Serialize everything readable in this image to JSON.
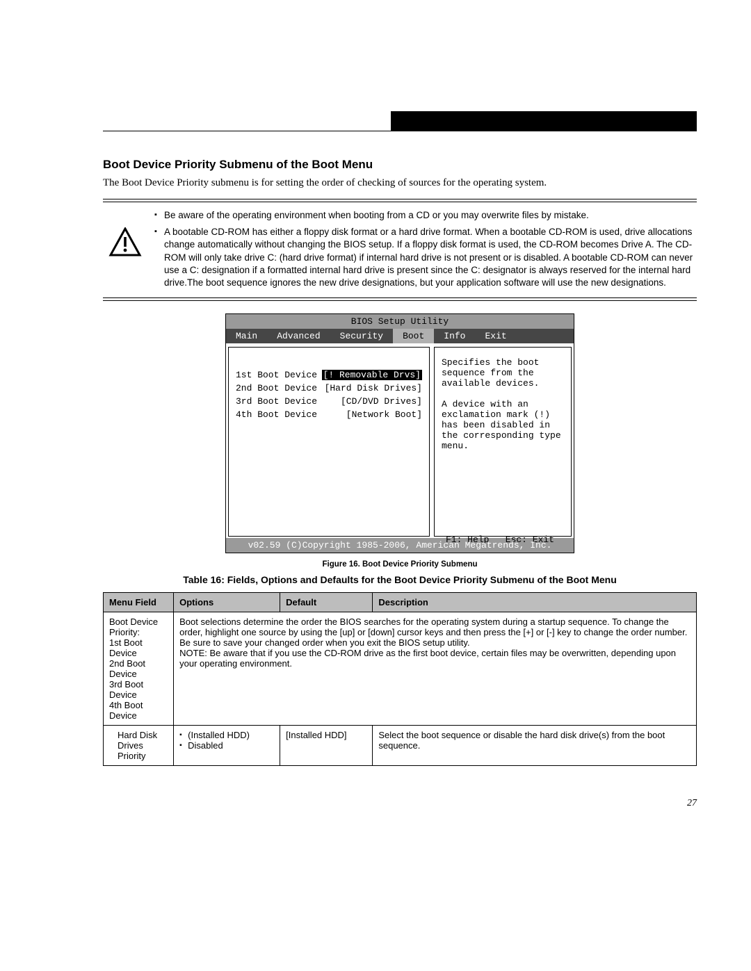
{
  "header": {
    "section_title": "Boot Device Priority Submenu of the Boot Menu",
    "intro": "The Boot Device Priority submenu is for setting the order of checking of sources for the operating system."
  },
  "notice": {
    "items": [
      "Be aware of the operating environment when booting from a CD or you may overwrite files by mistake.",
      "A bootable CD-ROM has either a floppy disk format or a hard drive format. When a bootable CD-ROM is used, drive allocations change automatically without changing the BIOS setup. If a floppy disk format is used, the CD-ROM becomes Drive A. The CD-ROM will only take drive C: (hard drive format) if internal hard drive is not present or is disabled. A bootable CD-ROM can never use a C: designation if a formatted internal hard drive is present since the C: designator is always reserved for the internal hard drive.The boot sequence ignores the new drive designations, but your application software will use the new designations."
    ]
  },
  "bios": {
    "title": "BIOS Setup Utility",
    "tabs": [
      "Main",
      "Advanced",
      "Security",
      "Boot",
      "Info",
      "Exit"
    ],
    "active_tab": "Boot",
    "left_rows": [
      {
        "label": "1st Boot Device",
        "value": "[! Removable Drvs]",
        "selected": true
      },
      {
        "label": "2nd Boot Device",
        "value": "[Hard Disk Drives]",
        "selected": false
      },
      {
        "label": "3rd Boot Device",
        "value": "[CD/DVD Drives]",
        "selected": false
      },
      {
        "label": "4th Boot Device",
        "value": "[Network Boot]",
        "selected": false
      }
    ],
    "right_text": "Specifies the boot sequence from the available devices.\n\nA device with an exclamation mark (!) has been disabled in the corresponding type menu.",
    "keys_line": "F1: Help   Esc: Exit",
    "footer": "v02.59 (C)Copyright 1985-2006, American Megatrends, Inc."
  },
  "figure_caption": "Figure 16.  Boot Device Priority Submenu",
  "table_title": "Table 16: Fields, Options and Defaults for the Boot Device Priority Submenu of the Boot Menu",
  "table": {
    "head": [
      "Menu Field",
      "Options",
      "Default",
      "Description"
    ],
    "row1": {
      "field": "Boot Device Priority:\n1st Boot Device\n2nd Boot Device\n3rd Boot Device\n4th Boot Device",
      "desc": "Boot selections determine the order the BIOS searches for the operating system during a startup sequence. To change the order, highlight one source by using the [up] or [down] cursor keys and then press the [+] or [-] key to change the order number. Be sure to save your changed order when you exit the BIOS setup utility.\nNOTE: Be aware that if you use the CD-ROM drive as the first boot device, certain files may be overwritten, depending upon your operating environment."
    },
    "row2": {
      "field": "Hard Disk Drives Priority",
      "options": [
        "(Installed HDD)",
        "Disabled"
      ],
      "default": "[Installed HDD]",
      "desc": "Select the boot sequence or disable the hard disk drive(s) from the boot sequence."
    }
  },
  "page_number": "27"
}
